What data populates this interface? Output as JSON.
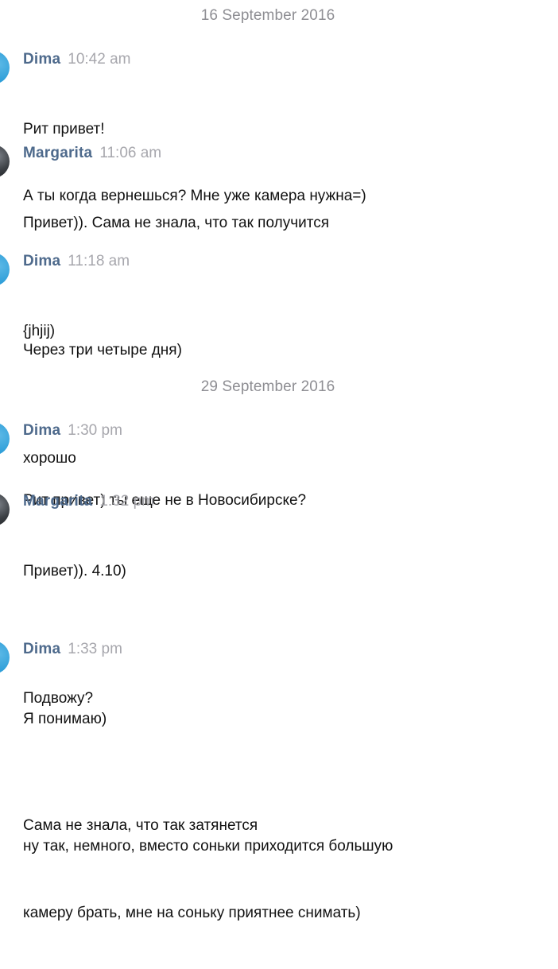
{
  "conversation": {
    "date_separators": [
      "16 September 2016",
      "29 September 2016"
    ],
    "groups": [
      {
        "sender": "Dima",
        "time": "10:42 am",
        "avatar": "dima",
        "paragraphs": [
          [
            "Рит привет!",
            "А ты когда вернешься? Мне уже камера нужна=)"
          ]
        ]
      },
      {
        "sender": "Margarita",
        "time": "11:06 am",
        "avatar": "margarita",
        "paragraphs": [
          [
            "Привет)). Сама не знала, что так получится"
          ],
          [
            "Через три четыре дня)"
          ]
        ]
      },
      {
        "sender": "Dima",
        "time": "11:18 am",
        "avatar": "dima",
        "paragraphs": [
          [
            "{jhjij)"
          ],
          [
            "хорошо"
          ]
        ]
      },
      {
        "sender": "Dima",
        "time": "1:30 pm",
        "avatar": "dima",
        "paragraphs": [
          [
            "Рит привет) ты еще не в Новосибирске?"
          ]
        ]
      },
      {
        "sender": "Margarita",
        "time": "1:32 pm",
        "avatar": "margarita",
        "paragraphs": [
          [
            "Привет)). 4.10)"
          ],
          [
            "Подвожу?"
          ],
          [
            "Сама не знала, что так затянется"
          ]
        ]
      },
      {
        "sender": "Dima",
        "time": "1:33 pm",
        "avatar": "dima",
        "paragraphs": [
          [
            "Я понимаю)"
          ],
          [
            "ну так, немного, вместо соньки приходится большую",
            "камеру брать, мне на соньку приятнее снимать)"
          ]
        ]
      }
    ]
  },
  "colors": {
    "sender": "#4e6a8c",
    "time": "#a7a7ad",
    "date_separator": "#8e8e93",
    "text": "#111111"
  }
}
